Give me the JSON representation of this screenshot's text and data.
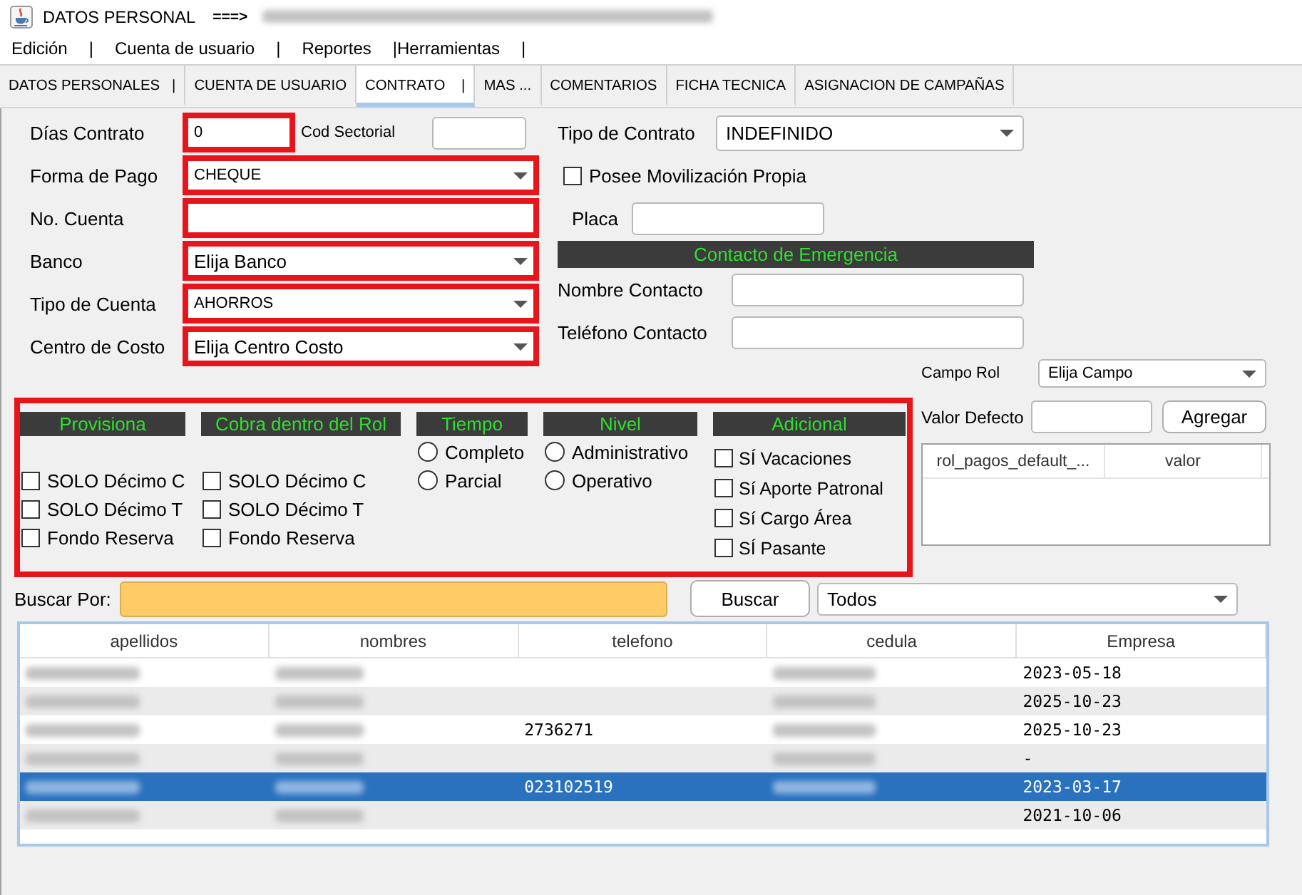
{
  "window": {
    "title": "DATOS PERSONAL",
    "title_arrow": "===>",
    "title_redacted": true
  },
  "menu": [
    {
      "label": "Edición",
      "separator": "|"
    },
    {
      "label": "Cuenta de usuario",
      "separator": "|"
    },
    {
      "label": "Reportes"
    },
    {
      "label": "|Herramientas",
      "separator": "|"
    }
  ],
  "tabs": [
    {
      "label": "DATOS PERSONALES   |",
      "selected": false
    },
    {
      "label": "CUENTA DE USUARIO",
      "selected": false
    },
    {
      "label": "CONTRATO    |",
      "selected": true
    },
    {
      "label": "MAS ...",
      "selected": false
    },
    {
      "label": "COMENTARIOS",
      "selected": false
    },
    {
      "label": "FICHA TECNICA",
      "selected": false
    },
    {
      "label": "ASIGNACION DE CAMPAÑAS",
      "selected": false
    }
  ],
  "left_fields": [
    {
      "kind": "text",
      "label": "Días Contrato",
      "value": "0",
      "small": true,
      "highlighted": true,
      "side_field": {
        "label": "Cod Sectorial"
      }
    },
    {
      "kind": "combo",
      "label": "Forma de Pago",
      "value": "CHEQUE",
      "small": true,
      "highlighted": true
    },
    {
      "kind": "text",
      "label": "No. Cuenta",
      "highlighted": true
    },
    {
      "kind": "combo",
      "label": "Banco",
      "value": "Elija Banco",
      "highlighted": true
    },
    {
      "kind": "combo",
      "label": "Tipo de Cuenta",
      "value": "AHORROS",
      "small": true,
      "highlighted": true
    },
    {
      "kind": "combo",
      "label": "Centro de Costo",
      "value": "Elija Centro Costo",
      "highlighted": true
    }
  ],
  "right": {
    "contract_type": {
      "label": "Tipo de Contrato",
      "value": "INDEFINIDO"
    },
    "own_vehicle": {
      "label": "Posee Movilización Propia",
      "checked": false
    },
    "plate": {
      "label": "Placa"
    },
    "emergency_contact": {
      "title": "Contacto de Emergencia",
      "fields": [
        {
          "label": "Nombre Contacto"
        },
        {
          "label": "Teléfono Contacto"
        }
      ]
    }
  },
  "options_panel": {
    "highlighted": true,
    "groups": [
      {
        "title": "Provisiona",
        "kind": "checkbox",
        "items": [
          {
            "label": "SOLO Décimo C",
            "checked": false
          },
          {
            "label": "SOLO Décimo T",
            "checked": false
          },
          {
            "label": "Fondo Reserva",
            "checked": false
          }
        ]
      },
      {
        "title": "Cobra dentro del Rol",
        "kind": "checkbox",
        "items": [
          {
            "label": "SOLO Décimo C",
            "checked": false
          },
          {
            "label": "SOLO Décimo T",
            "checked": false
          },
          {
            "label": "Fondo Reserva",
            "checked": false
          }
        ]
      },
      {
        "title": "Tiempo",
        "kind": "radio",
        "items": [
          {
            "label": "Completo",
            "selected": false
          },
          {
            "label": "Parcial",
            "selected": false
          }
        ]
      },
      {
        "title": "Nivel",
        "kind": "radio",
        "items": [
          {
            "label": "Administrativo",
            "selected": false
          },
          {
            "label": "Operativo",
            "selected": false
          }
        ]
      },
      {
        "title": "Adicional",
        "kind": "checkbox",
        "items": [
          {
            "label": "SÍ Vacaciones",
            "checked": false
          },
          {
            "label": "Sí Aporte Patronal",
            "checked": false
          },
          {
            "label": "Sí Cargo Área",
            "checked": false
          },
          {
            "label": "SÍ Pasante",
            "checked": false
          }
        ]
      }
    ]
  },
  "rol_panel": {
    "field_combo": {
      "label": "Campo Rol",
      "value": "Elija Campo"
    },
    "default_value": {
      "label": "Valor Defecto"
    },
    "add_button": "Agregar",
    "table": {
      "columns": [
        "rol_pagos_default_...",
        "valor"
      ]
    }
  },
  "search": {
    "label": "Buscar Por:",
    "highlighted": true,
    "button": "Buscar",
    "filter": "Todos"
  },
  "table": {
    "columns": [
      "apellidos",
      "nombres",
      "telefono",
      "cedula",
      "Empresa"
    ],
    "rows": [
      {
        "selected": false,
        "cells": [
          {
            "kind": "blurred"
          },
          {
            "kind": "blurred"
          },
          {
            "kind": "empty"
          },
          {
            "kind": "blurred"
          },
          {
            "kind": "text",
            "text": "2023-05-18"
          }
        ]
      },
      {
        "selected": false,
        "cells": [
          {
            "kind": "blurred"
          },
          {
            "kind": "blurred"
          },
          {
            "kind": "empty"
          },
          {
            "kind": "blurred"
          },
          {
            "kind": "text",
            "text": "2025-10-23"
          }
        ]
      },
      {
        "selected": false,
        "cells": [
          {
            "kind": "blurred"
          },
          {
            "kind": "blurred"
          },
          {
            "kind": "text",
            "text": "2736271"
          },
          {
            "kind": "blurred"
          },
          {
            "kind": "text",
            "text": "2025-10-23"
          }
        ]
      },
      {
        "selected": false,
        "cells": [
          {
            "kind": "blurred"
          },
          {
            "kind": "blurred"
          },
          {
            "kind": "empty"
          },
          {
            "kind": "blurred"
          },
          {
            "kind": "text",
            "text": "-"
          }
        ]
      },
      {
        "selected": true,
        "cells": [
          {
            "kind": "blurred"
          },
          {
            "kind": "blurred"
          },
          {
            "kind": "text",
            "text": "023102519"
          },
          {
            "kind": "blurred"
          },
          {
            "kind": "text",
            "text": "2023-03-17"
          }
        ]
      },
      {
        "selected": false,
        "cells": [
          {
            "kind": "blurred"
          },
          {
            "kind": "blurred"
          },
          {
            "kind": "empty"
          },
          {
            "kind": "empty"
          },
          {
            "kind": "text",
            "text": "2021-10-06"
          }
        ]
      }
    ]
  }
}
